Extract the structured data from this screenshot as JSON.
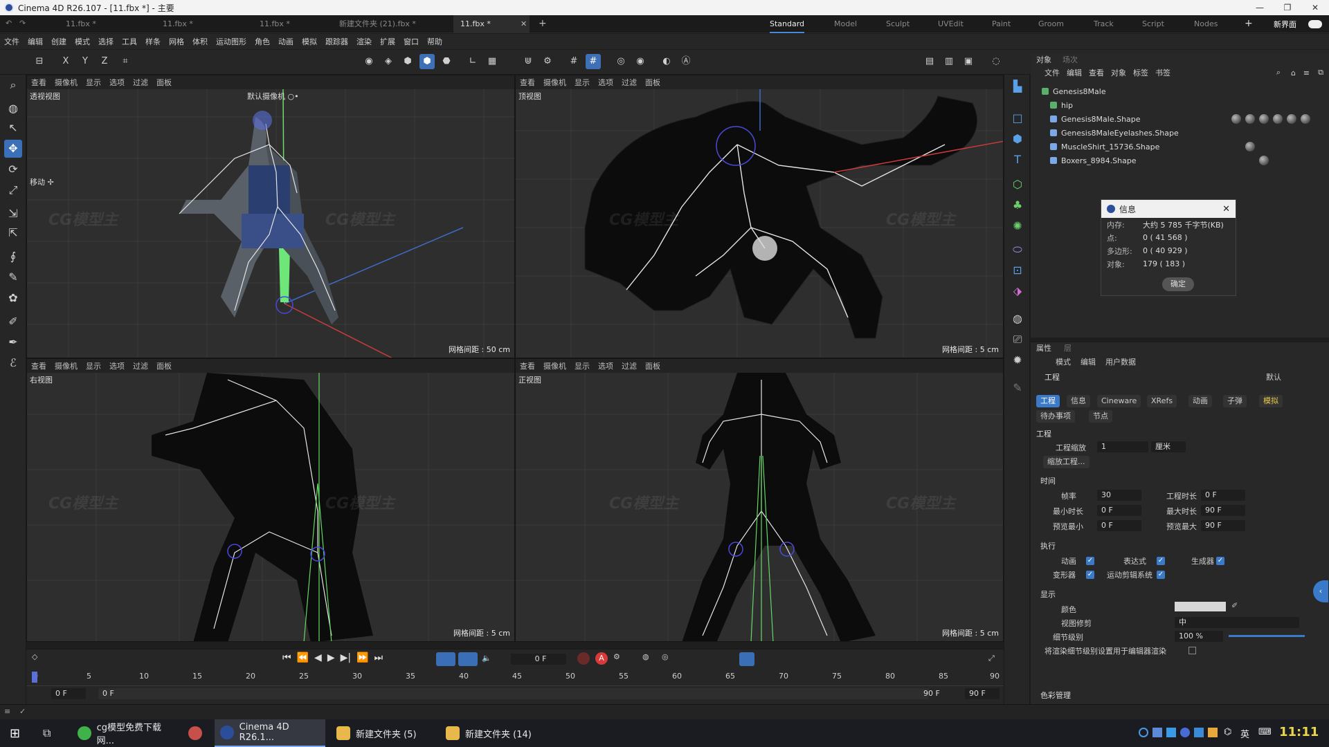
{
  "window": {
    "title": "Cinema 4D R26.107 - [11.fbx *] - 主要",
    "controls": [
      "—",
      "❐",
      "✕"
    ]
  },
  "doc_tabs": [
    "11.fbx *",
    "11.fbx *",
    "11.fbx *",
    "新建文件夹 (21).fbx *",
    "11.fbx *"
  ],
  "layout_tabs": [
    "Standard",
    "Model",
    "Sculpt",
    "UVEdit",
    "Paint",
    "Groom",
    "Track",
    "Script",
    "Nodes"
  ],
  "layout_active": "Standard",
  "new_interface_label": "新界面",
  "menu": [
    "文件",
    "编辑",
    "创建",
    "模式",
    "选择",
    "工具",
    "样条",
    "网格",
    "体积",
    "运动图形",
    "角色",
    "动画",
    "模拟",
    "跟踪器",
    "渲染",
    "扩展",
    "窗口",
    "帮助"
  ],
  "toolbar_axes": [
    "X",
    "Y",
    "Z"
  ],
  "viewport_menu": [
    "查看",
    "摄像机",
    "显示",
    "选项",
    "过滤",
    "面板"
  ],
  "viewports": [
    {
      "name": "透视视图",
      "camera": "默认摄像机 ○•",
      "grid": "网格间距 : 50 cm",
      "tool_label": "移动 ✢"
    },
    {
      "name": "顶视图",
      "grid": "网格间距 : 5 cm"
    },
    {
      "name": "右视图",
      "grid": "网格间距 : 5 cm"
    },
    {
      "name": "正视图",
      "grid": "网格间距 : 5 cm"
    }
  ],
  "object_panel": {
    "tabs": [
      "对象",
      "场次"
    ],
    "menu": [
      "文件",
      "编辑",
      "查看",
      "对象",
      "标签",
      "书签"
    ],
    "objects": [
      {
        "name": "Genesis8Male",
        "indent": 0
      },
      {
        "name": "hip",
        "indent": 1
      },
      {
        "name": "Genesis8Male.Shape",
        "indent": 1
      },
      {
        "name": "Genesis8MaleEyelashes.Shape",
        "indent": 1
      },
      {
        "name": "MuscleShirt_15736.Shape",
        "indent": 1
      },
      {
        "name": "Boxers_8984.Shape",
        "indent": 1
      }
    ]
  },
  "info_dialog": {
    "title": "信息",
    "rows": [
      {
        "k": "内存:",
        "v": "大约 5 785 千字节(KB)"
      },
      {
        "k": "点:",
        "v": "0 ( 41 568 )"
      },
      {
        "k": "多边形:",
        "v": "0 ( 40 929 )"
      },
      {
        "k": "对象:",
        "v": "179 ( 183 )"
      }
    ],
    "ok": "确定"
  },
  "attributes": {
    "tabs": [
      "属性",
      "层"
    ],
    "menu": [
      "模式",
      "编辑",
      "用户数据"
    ],
    "header": "工程",
    "preset": "默认",
    "sub_tabs": [
      "工程",
      "信息",
      "Cineware",
      "XRefs",
      "动画",
      "子弹",
      "模拟"
    ],
    "sub_tabs2": [
      "待办事项",
      "节点"
    ],
    "section": "工程",
    "scale_label": "工程缩放",
    "scale_value": "1",
    "scale_unit": "厘米",
    "scale_button": "缩放工程...",
    "time_section": "时间",
    "fps_label": "帧率",
    "fps": "30",
    "proj_len_label": "工程时长",
    "proj_len": "0 F",
    "min_label": "最小时长",
    "min": "0 F",
    "max_label": "最大时长",
    "max": "90 F",
    "pmin_label": "预览最小",
    "pmin": "0 F",
    "pmax_label": "预览最大",
    "pmax": "90 F",
    "exec_section": "执行",
    "exec": [
      "动画",
      "表达式",
      "生成器",
      "变形器",
      "运动剪辑系统"
    ],
    "display_section": "显示",
    "color_label": "颜色",
    "clip_label": "视图修剪",
    "clip_value": "中",
    "lod_label": "细节级别",
    "lod_value": "100 %",
    "render_lod_label": "将渲染细节级别设置用于编辑器渲染",
    "color_mgmt": "色彩管理"
  },
  "timeline": {
    "ticks": [
      "0",
      "5",
      "10",
      "15",
      "20",
      "25",
      "30",
      "35",
      "40",
      "45",
      "50",
      "55",
      "60",
      "65",
      "70",
      "75",
      "80",
      "85",
      "90"
    ],
    "current_frame": "0 F",
    "start": "0 F",
    "start2": "0 F",
    "end": "90 F",
    "end2": "90 F"
  },
  "taskbar": {
    "items": [
      "cg模型免费下载网...",
      "Cinema 4D R26.1...",
      "新建文件夹 (5)",
      "新建文件夹 (14)"
    ],
    "active": "Cinema 4D R26.1...",
    "ime": "英",
    "clock": "11:11"
  },
  "watermark": "CG模型主"
}
